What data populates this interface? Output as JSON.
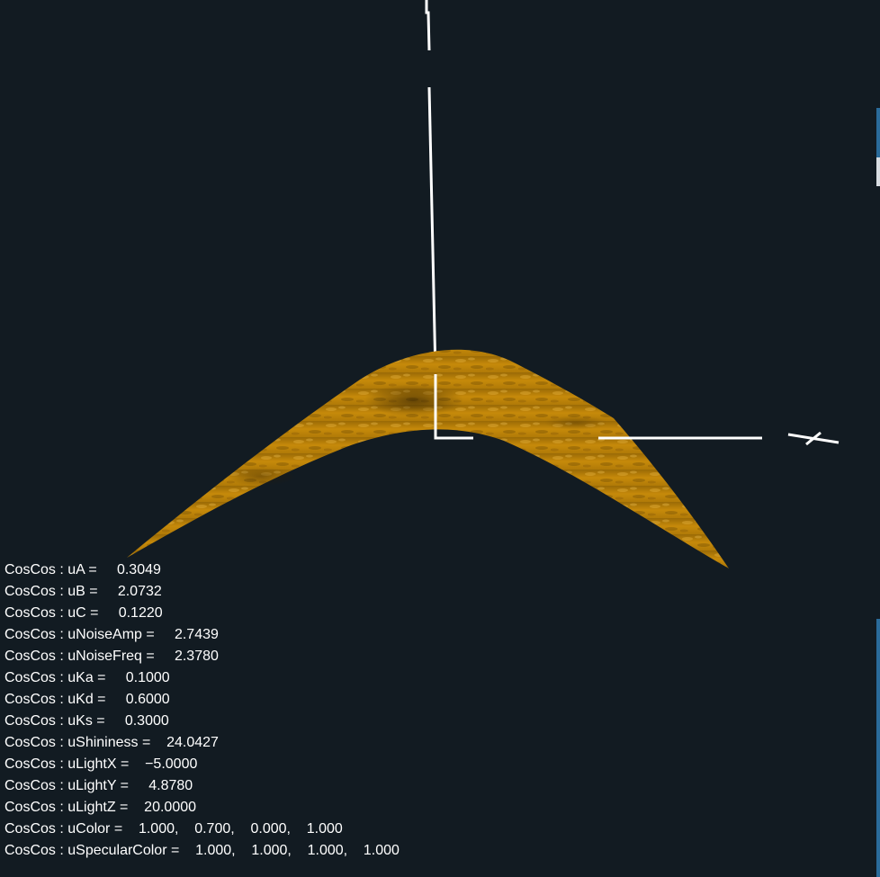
{
  "viewport": {
    "background_color": "#121b22",
    "surface_color": "#c68a0a",
    "axis_color": "#ffffff"
  },
  "axes": {
    "x_label": "X"
  },
  "uniforms": [
    {
      "text": "CosCos : uA =     0.3049"
    },
    {
      "text": "CosCos : uB =     2.0732"
    },
    {
      "text": "CosCos : uC =     0.1220"
    },
    {
      "text": "CosCos : uNoiseAmp =     2.7439"
    },
    {
      "text": "CosCos : uNoiseFreq =     2.3780"
    },
    {
      "text": "CosCos : uKa =     0.1000"
    },
    {
      "text": "CosCos : uKd =     0.6000"
    },
    {
      "text": "CosCos : uKs =     0.3000"
    },
    {
      "text": "CosCos : uShininess =    24.0427"
    },
    {
      "text": "CosCos : uLightX =    −5.0000"
    },
    {
      "text": "CosCos : uLightY =     4.8780"
    },
    {
      "text": "CosCos : uLightZ =    20.0000"
    },
    {
      "text": "CosCos : uColor =    1.000,    0.700,    0.000,    1.000"
    },
    {
      "text": "CosCos : uSpecularColor =    1.000,    1.000,    1.000,    1.000"
    }
  ]
}
